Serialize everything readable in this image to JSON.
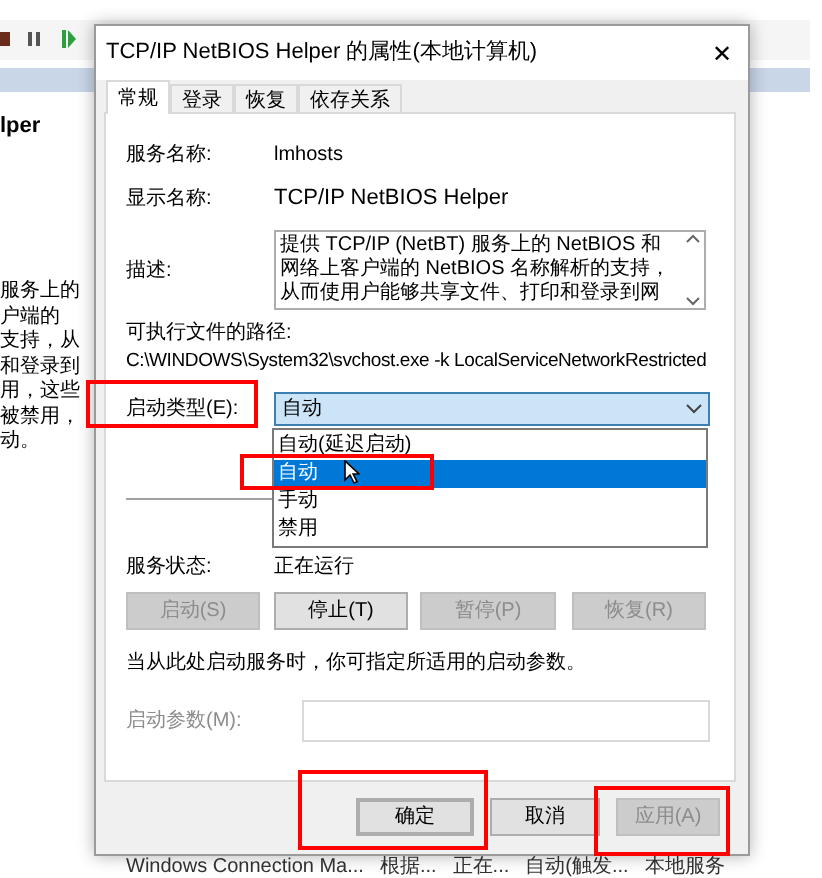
{
  "background_window": {
    "detail_title": "lper",
    "description_lines": [
      "服务上的",
      "户端的",
      "支持，从",
      "和登录到",
      "用，这些",
      "被禁用，",
      "动。"
    ],
    "list_row": [
      "Windows Connection Ma...",
      "根据...",
      "正在...",
      "自动(触发...",
      "本地服务"
    ]
  },
  "dialog": {
    "title": "TCP/IP NetBIOS Helper 的属性(本地计算机)",
    "close": "✕",
    "tabs": [
      {
        "label": "常规",
        "selected": true
      },
      {
        "label": "登录",
        "selected": false
      },
      {
        "label": "恢复",
        "selected": false
      },
      {
        "label": "依存关系",
        "selected": false
      }
    ],
    "service_name": {
      "label": "服务名称:",
      "value": "lmhosts"
    },
    "display_name": {
      "label": "显示名称:",
      "value": "TCP/IP NetBIOS Helper"
    },
    "description": {
      "label": "描述:",
      "value": "提供 TCP/IP (NetBT) 服务上的 NetBIOS 和网络上客户端的 NetBIOS 名称解析的支持，从而使用户能够共享文件、打印和登录到网"
    },
    "path": {
      "label": "可执行文件的路径:",
      "value": "C:\\WINDOWS\\System32\\svchost.exe -k LocalServiceNetworkRestricted"
    },
    "startup_type": {
      "label": "启动类型(E):",
      "value": "自动",
      "expanded": true,
      "options": [
        {
          "label": "自动(延迟启动)",
          "selected": false
        },
        {
          "label": "自动",
          "selected": true
        },
        {
          "label": "手动",
          "selected": false
        },
        {
          "label": "禁用",
          "selected": false
        }
      ]
    },
    "service_status": {
      "label": "服务状态:",
      "value": "正在运行"
    },
    "control_buttons": [
      {
        "label": "启动(S)",
        "disabled": true
      },
      {
        "label": "停止(T)",
        "disabled": false
      },
      {
        "label": "暂停(P)",
        "disabled": true
      },
      {
        "label": "恢复(R)",
        "disabled": true
      }
    ],
    "hint": "当从此处启动服务时，你可指定所适用的启动参数。",
    "start_params": {
      "label": "启动参数(M):",
      "disabled": true
    },
    "footer_buttons": [
      {
        "label": "确定",
        "disabled": false,
        "default": true
      },
      {
        "label": "取消",
        "disabled": false,
        "default": false
      },
      {
        "label": "应用(A)",
        "disabled": true,
        "default": false
      }
    ]
  }
}
